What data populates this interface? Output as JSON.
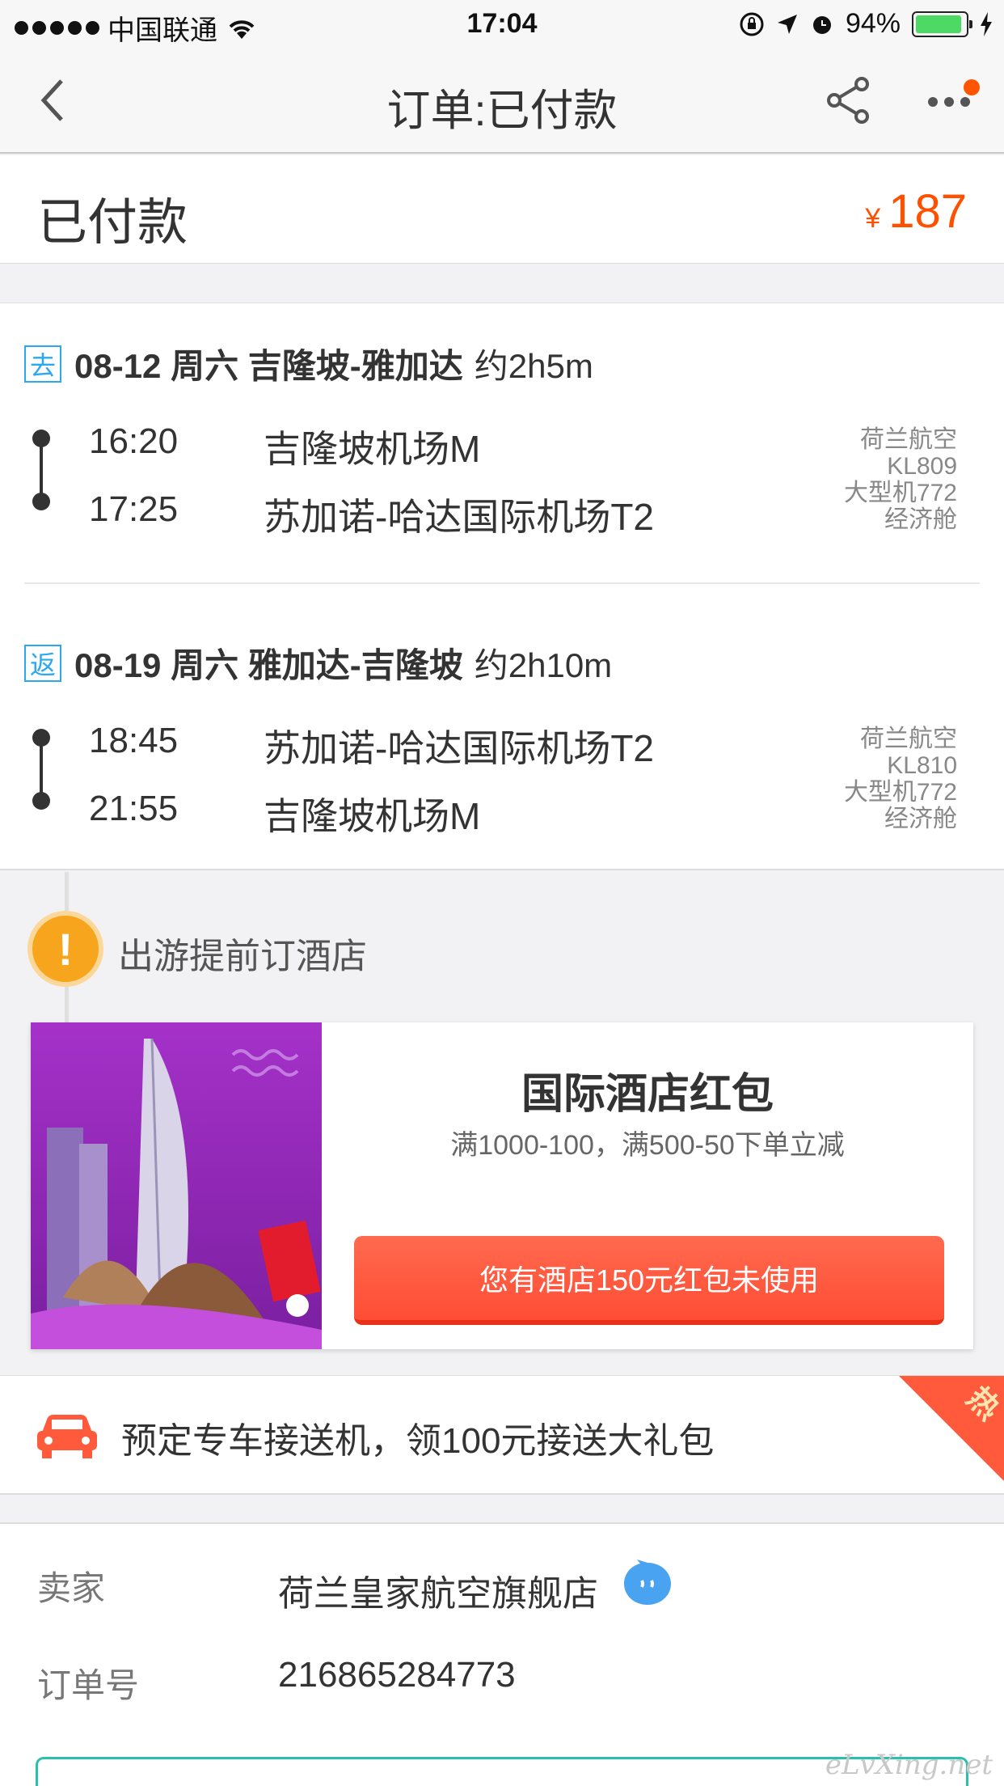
{
  "status_bar": {
    "carrier": "中国联通",
    "time": "17:04",
    "battery": "94%"
  },
  "nav": {
    "title": "订单:已付款"
  },
  "order_status": {
    "label": "已付款",
    "currency": "¥",
    "amount": "187"
  },
  "outbound": {
    "tag": "去",
    "date": "08-12 周六 吉隆坡-雅加达",
    "duration": "约2h5m",
    "dep_time": "16:20",
    "dep_airport": "吉隆坡机场M",
    "arr_time": "17:25",
    "arr_airport": "苏加诺-哈达国际机场T2",
    "airline": "荷兰航空",
    "flight_no": "KL809",
    "aircraft": "大型机772",
    "cabin": "经济舱"
  },
  "return": {
    "tag": "返",
    "date": "08-19 周六 雅加达-吉隆坡",
    "duration": "约2h10m",
    "dep_time": "18:45",
    "dep_airport": "苏加诺-哈达国际机场T2",
    "arr_time": "21:55",
    "arr_airport": "吉隆坡机场M",
    "airline": "荷兰航空",
    "flight_no": "KL810",
    "aircraft": "大型机772",
    "cabin": "经济舱"
  },
  "hotel": {
    "section_title": "出游提前订酒店",
    "card_title": "国际酒店红包",
    "card_subtitle": "满1000-100，满500-50下单立减",
    "button_label": "您有酒店150元红包未使用"
  },
  "car": {
    "text": "预定专车接送机，领100元接送大礼包",
    "hot_badge": "热"
  },
  "seller": {
    "seller_key": "卖家",
    "seller_value": "荷兰皇家航空旗舰店",
    "order_key": "订单号",
    "order_value": "216865284773"
  },
  "watermark": "eLvXing.net",
  "colors": {
    "accent_price": "#ff5000",
    "tag_blue": "#2aa8f0",
    "button_red": "#ff4d35"
  }
}
